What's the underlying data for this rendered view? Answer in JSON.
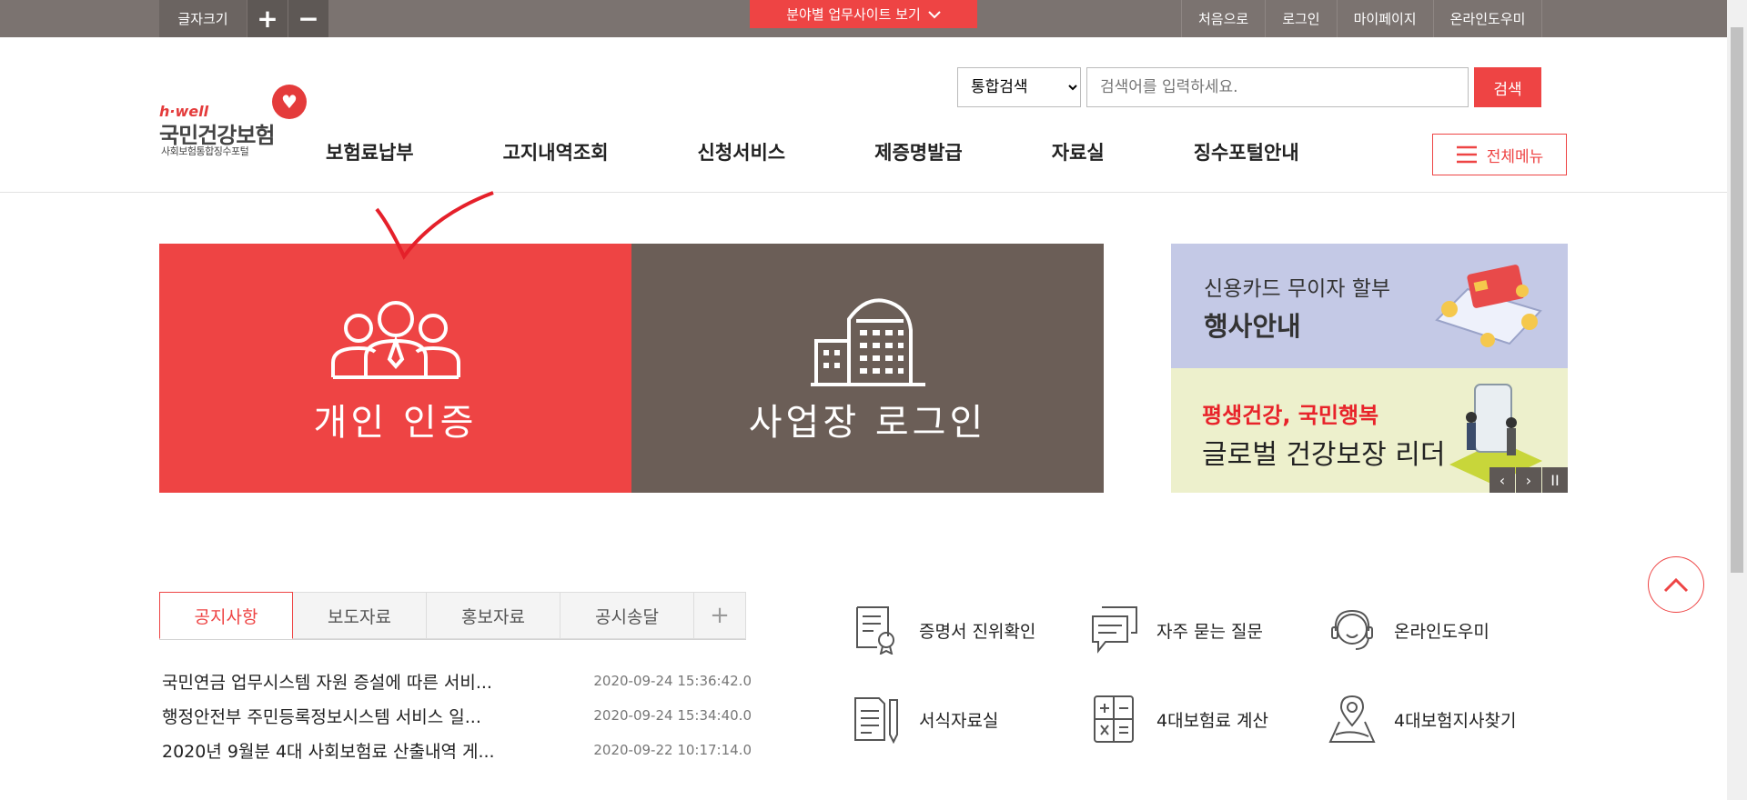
{
  "topbar": {
    "fontsize_label": "글자크기",
    "plus": "+",
    "minus": "−",
    "field_site": "분야별 업무사이트 보기",
    "links": [
      "처음으로",
      "로그인",
      "마이페이지",
      "온라인도우미"
    ]
  },
  "logo": {
    "brand": "h·well",
    "name": "국민건강보험",
    "sub": "사회보험통합징수포털"
  },
  "search": {
    "scope": "통합검색",
    "placeholder": "검색어를 입력하세요.",
    "button": "검색"
  },
  "gnb": [
    "보험료납부",
    "고지내역조회",
    "신청서비스",
    "제증명발급",
    "자료실",
    "징수포털안내"
  ],
  "all_menu": "전체메뉴",
  "cards": {
    "personal": "개인 인증",
    "business": "사업장 로그인"
  },
  "banner": {
    "b1_line1": "신용카드 무이자 할부",
    "b1_line2": "행사안내",
    "b2_line1": "평생건강, 국민행복",
    "b2_line2": "글로벌 건강보장 리더",
    "prev": "‹",
    "next": "›",
    "pause": "II"
  },
  "tabs": [
    "공지사항",
    "보도자료",
    "홍보자료",
    "공시송달",
    "+"
  ],
  "news": [
    {
      "title": "국민연금 업무시스템 자원 증설에 따른 서비...",
      "date": "2020-09-24 15:36:42.0"
    },
    {
      "title": "행정안전부 주민등록정보시스템 서비스 일...",
      "date": "2020-09-24 15:34:40.0"
    },
    {
      "title": "2020년 9월분 4대 사회보험료 산출내역 게...",
      "date": "2020-09-22 10:17:14.0"
    }
  ],
  "quick": [
    "증명서 진위확인",
    "자주 묻는 질문",
    "온라인도우미",
    "서식자료실",
    "4대보험료 계산",
    "4대보험지사찾기"
  ],
  "colors": {
    "accent": "#ee4444",
    "topbar": "#7b7370",
    "business": "#6b5e57"
  }
}
